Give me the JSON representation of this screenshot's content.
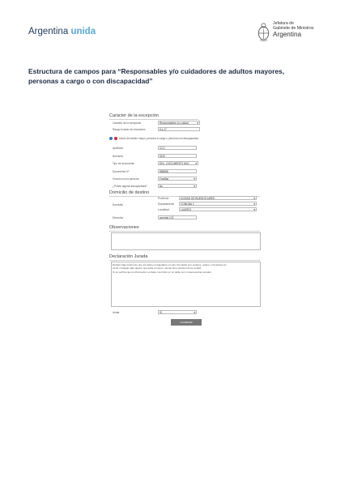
{
  "header": {
    "brand_main": "Argentina",
    "brand_accent": "unida",
    "agency_line1": "Jefatura de",
    "agency_line2": "Gabinete de Ministros",
    "agency_country": "Argentina"
  },
  "page_title": "Estructura de campos para “Responsables y/o cuidadores de adultos mayores, personas a cargo o con discapacidad”",
  "form": {
    "excepcion": {
      "heading": "Carácter de la excepción",
      "caracter_label": "Carácter de la excepción",
      "caracter_value": "Responsables y/o cuidad",
      "rango_label": "Rango horario de circulación",
      "rango_value": "8 a 17",
      "radio_text": "Datos del adulto mayor, persona a cargo o persona con discapacidad",
      "apellidos_label": "Apellidos",
      "apellidos_value": "CCC",
      "nombres_label": "Nombres",
      "nombres_value": "DDD",
      "tipo_doc_label": "Tipo de documento",
      "tipo_doc_value": "DNI - DOCUMENTO NAC",
      "num_doc_label": "Documento N°",
      "num_doc_value": "888888",
      "vinculo_label": "Vínculo con la persona",
      "vinculo_value": "Familiar",
      "discapacidad_label": "¿Posee alguna discapacidad?",
      "discapacidad_value": "No"
    },
    "domicilio": {
      "heading": "Domicilio de destino",
      "domicilio_label": "Domicilio",
      "provincia_label": "Provincia",
      "provincia_value": "CIUDAD DE BUENOS AIRES",
      "departamento_label": "Departamento",
      "departamento_value": "COMUNA 2",
      "localidad_label": "Localidad",
      "localidad_value": "LAUREG",
      "direccion_label": "Dirección",
      "direccion_value": "avenida 123"
    },
    "observaciones": {
      "heading": "Observaciones"
    },
    "declaracion": {
      "heading": "Declaración Jurada",
      "line1": "Declaro bajo juramento que los datos consignados en este formulario son veraces, reales y completos sin",
      "line2": "omitir ni falsear dato alguno que deba contener, siendo fiel expresión de la verdad.",
      "line3": "Si se verifica que la información es falsa, incurrirán en un delito con consecuencias penales.",
      "unida_label": "Unida",
      "unida_value": "Sí",
      "submit_label": "GUARDAR"
    }
  },
  "colors": {
    "brand_dark": "#1f3a5f",
    "brand_light": "#5aa6d6",
    "button": "#777777",
    "radio_blue": "#3b6fc4",
    "radio_red": "#c8302c"
  }
}
